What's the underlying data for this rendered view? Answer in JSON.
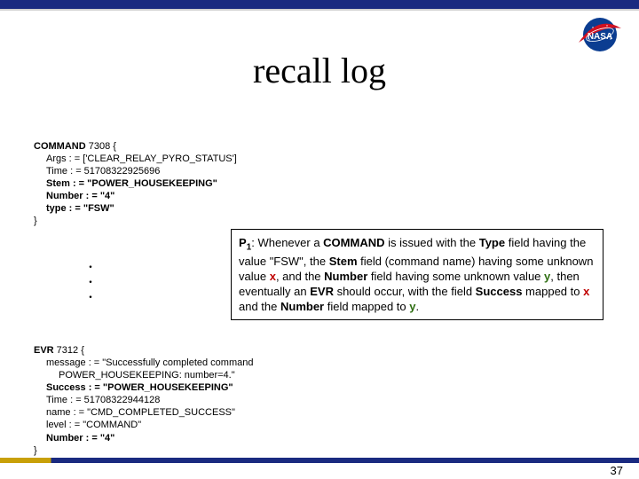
{
  "title": "recall log",
  "page_number": "37",
  "command_block": {
    "header_kw": "COMMAND",
    "header_rest": " 7308 {",
    "args": "Args : = ['CLEAR_RELAY_PYRO_STATUS']",
    "time": "Time : = 51708322925696",
    "stem": "Stem : = \"POWER_HOUSEKEEPING\"",
    "number": "Number : = \"4\"",
    "type": "type : = \"FSW\"",
    "close": "}"
  },
  "dots": ". . .",
  "callout": {
    "label": "P",
    "sub": "1",
    "t1": ": Whenever a ",
    "kw_command": "COMMAND",
    "t2": " is issued with the ",
    "kw_type": "Type",
    "t3": " field having the value \"FSW\", the ",
    "kw_stem": "Stem",
    "t4": " field (command name) having some unknown value ",
    "var_x1": "x",
    "t5": ", and the ",
    "kw_number": "Number",
    "t6": " field having some unknown value ",
    "var_y1": "y",
    "t7": ", then eventually an ",
    "kw_evr": "EVR",
    "t8": " should occur, with the field ",
    "kw_success": "Success",
    "t9": " mapped to ",
    "var_x2": "x",
    "t10": " and the ",
    "kw_number2": "Number",
    "t11": " field mapped to ",
    "var_y2": "y",
    "t12": "."
  },
  "evr_block": {
    "header_kw": "EVR",
    "header_rest": " 7312 {",
    "msg1": "message : = \"Successfully completed command",
    "msg2": "POWER_HOUSEKEEPING: number=4.\"",
    "success": "Success : = \"POWER_HOUSEKEEPING\"",
    "time": "Time : = 51708322944128",
    "name": "name : = \"CMD_COMPLETED_SUCCESS\"",
    "level": "level : = \"COMMAND\"",
    "number": "Number : = \"4\"",
    "close": "}"
  }
}
